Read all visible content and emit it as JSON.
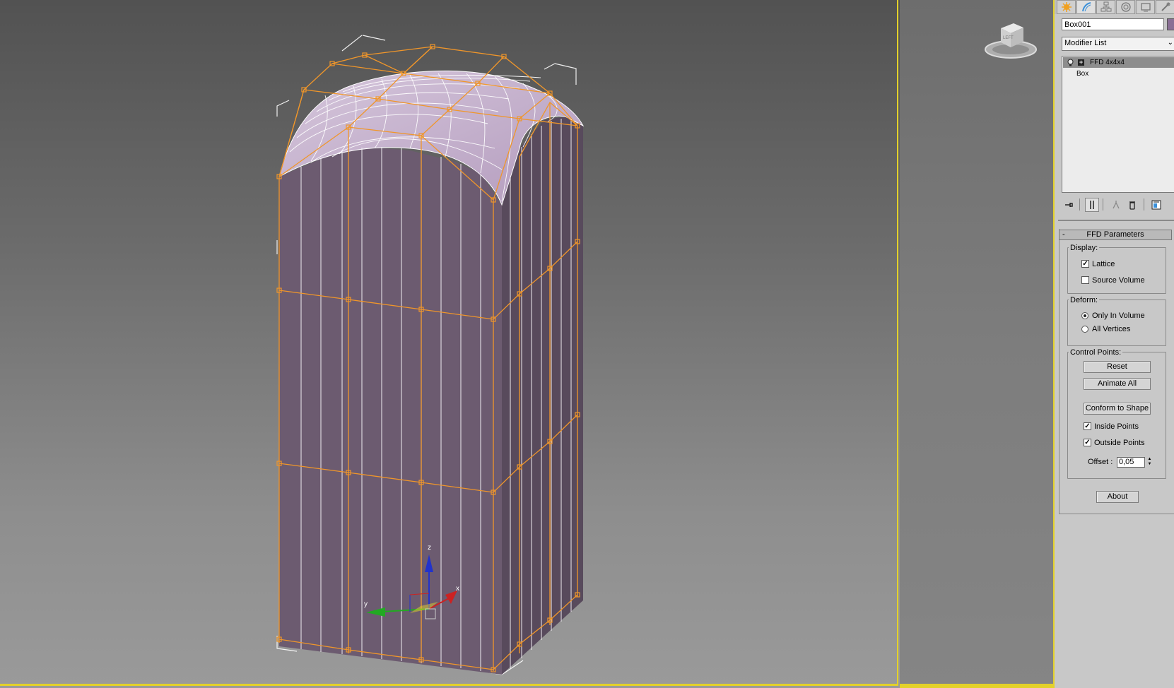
{
  "viewport": {
    "background_top": "#525252",
    "background_bottom": "#9a9a9a",
    "active_border_color": "#e3d12a",
    "object_color": "#6c5b70",
    "lattice_color": "#f0962a",
    "viewcube_label": "LEFT",
    "axis_labels": {
      "x": "x",
      "y": "y",
      "z": "z"
    },
    "axis_colors": {
      "x": "#cc2222",
      "y": "#22aa22",
      "z": "#2233cc"
    }
  },
  "command_panel": {
    "tabs": [
      "create-icon",
      "modify-icon",
      "hierarchy-icon",
      "motion-icon",
      "display-icon",
      "utilities-icon"
    ],
    "object_name": "Box001",
    "object_color": "#8a6f95",
    "modifier_list": {
      "label": "Modifier List"
    },
    "stack": [
      {
        "label": "FFD 4x4x4",
        "selected": true
      },
      {
        "label": "Box",
        "selected": false
      }
    ],
    "stack_tools": [
      "pin-stack-icon",
      "show-end-result-icon",
      "make-unique-icon",
      "remove-modifier-icon",
      "configure-modifier-sets-icon"
    ],
    "rollout": {
      "title": "FFD Parameters",
      "collapse": "-",
      "display": {
        "label": "Display:",
        "lattice": {
          "label": "Lattice",
          "checked": true
        },
        "source_volume": {
          "label": "Source Volume",
          "checked": false
        }
      },
      "deform": {
        "label": "Deform:",
        "only_in_volume": {
          "label": "Only In Volume",
          "selected": true
        },
        "all_vertices": {
          "label": "All Vertices",
          "selected": false
        }
      },
      "control_points": {
        "label": "Control Points:",
        "reset": "Reset",
        "animate_all": "Animate All",
        "conform_to_shape": "Conform to Shape",
        "inside_points": {
          "label": "Inside Points",
          "checked": true
        },
        "outside_points": {
          "label": "Outside Points",
          "checked": true
        },
        "offset": {
          "label": "Offset :",
          "value": "0,05"
        }
      },
      "about": "About"
    }
  }
}
